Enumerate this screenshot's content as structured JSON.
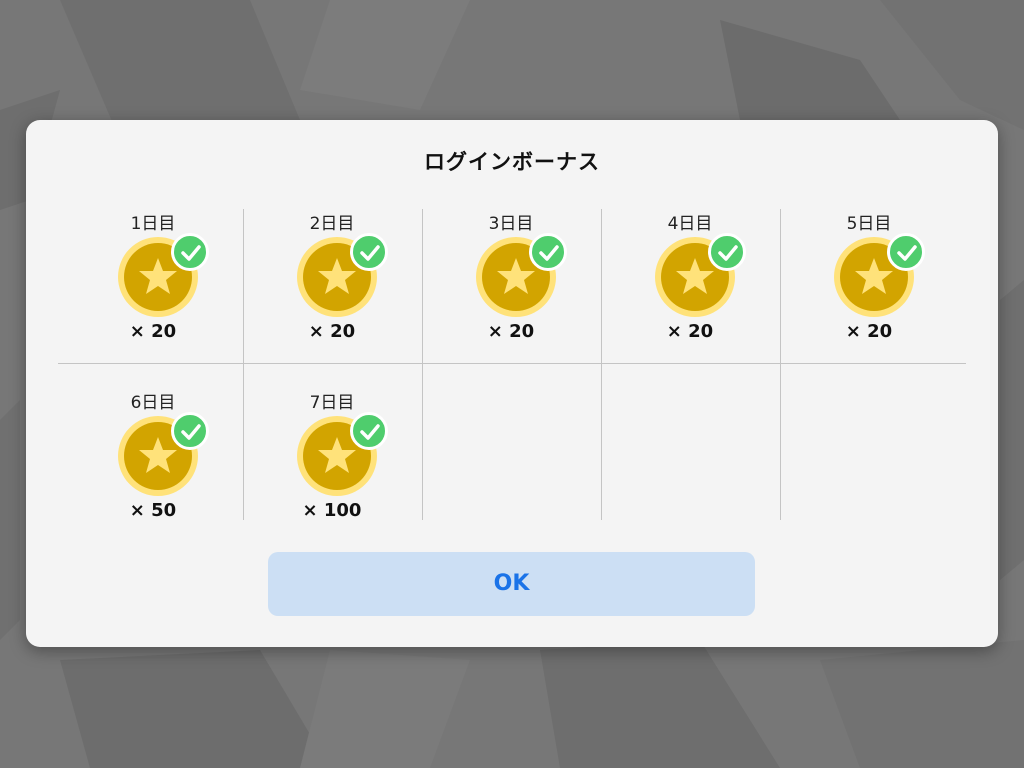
{
  "dialog": {
    "title": "ログインボーナス",
    "ok_label": "OK"
  },
  "rewards": [
    {
      "day": "1日目",
      "amount": "× 20",
      "claimed": true
    },
    {
      "day": "2日目",
      "amount": "× 20",
      "claimed": true
    },
    {
      "day": "3日目",
      "amount": "× 20",
      "claimed": true
    },
    {
      "day": "4日目",
      "amount": "× 20",
      "claimed": true
    },
    {
      "day": "5日目",
      "amount": "× 20",
      "claimed": true
    },
    {
      "day": "6日目",
      "amount": "× 50",
      "claimed": true
    },
    {
      "day": "7日目",
      "amount": "× 100",
      "claimed": true
    }
  ],
  "icons": {
    "reward": "star-coin-icon",
    "claimed": "checkmark-icon"
  },
  "colors": {
    "coin_outer": "#ffe27a",
    "coin_inner": "#d2a400",
    "star": "#ffe27a",
    "check_badge": "#4fcd6d",
    "ok_button_bg": "#ccdff4",
    "ok_button_text": "#1a73e8",
    "dialog_bg": "#f4f4f4",
    "backdrop": "#777777"
  }
}
